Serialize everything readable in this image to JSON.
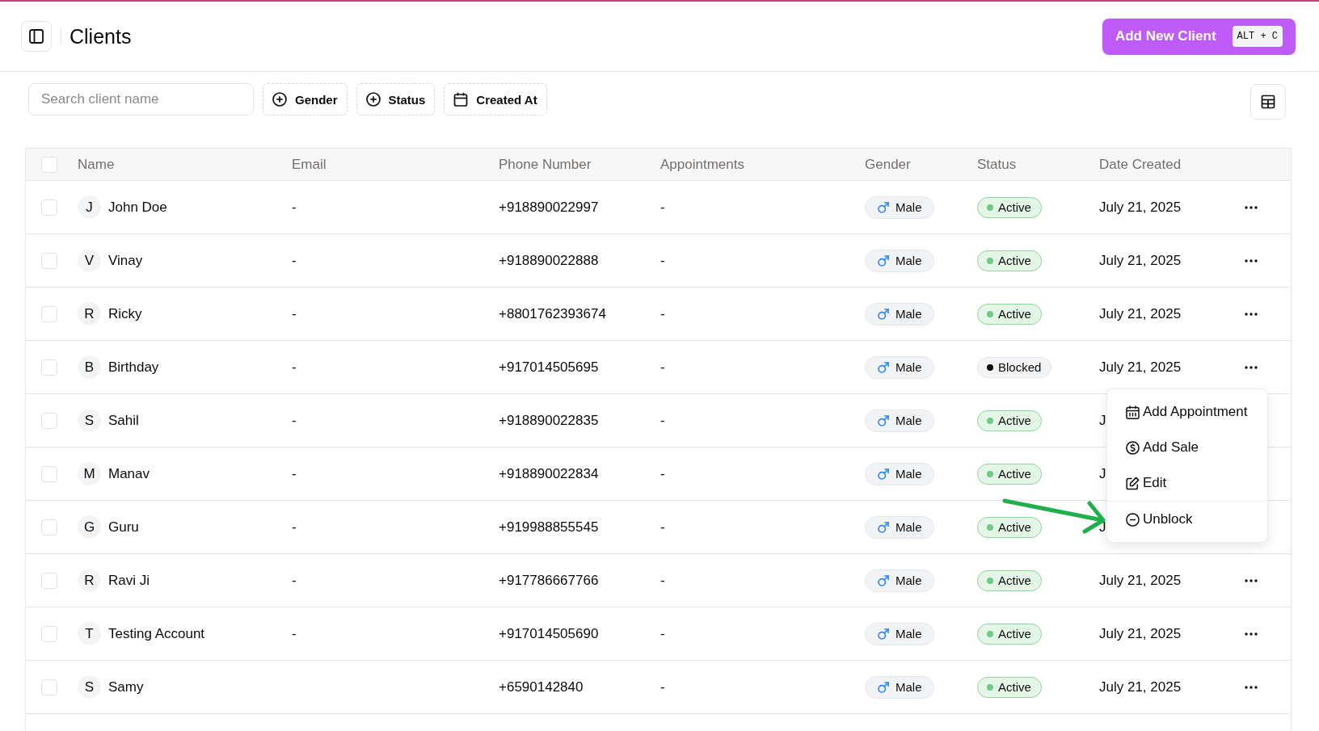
{
  "header": {
    "title": "Clients",
    "add_button": {
      "label": "Add New Client",
      "shortcut": "ALT + C"
    }
  },
  "toolbar": {
    "search": {
      "placeholder": "Search client name"
    },
    "filters": [
      {
        "label": "Gender",
        "kind": "add"
      },
      {
        "label": "Status",
        "kind": "add"
      },
      {
        "label": "Created At",
        "kind": "calendar"
      }
    ]
  },
  "table": {
    "select_all": {
      "checked": false
    },
    "columns": [
      "Name",
      "Email",
      "Phone Number",
      "Appointments",
      "Gender",
      "Status",
      "Date Created"
    ],
    "rows": [
      {
        "checked": false,
        "initial": "J",
        "name": "John Doe",
        "email": "-",
        "phone": "+918890022997",
        "appointments": "-",
        "gender": {
          "label": "Male",
          "kind": "male"
        },
        "status": {
          "label": "Active",
          "kind": "active"
        },
        "date": "July 21, 2025"
      },
      {
        "checked": false,
        "initial": "V",
        "name": "Vinay",
        "email": "-",
        "phone": "+918890022888",
        "appointments": "-",
        "gender": {
          "label": "Male",
          "kind": "male"
        },
        "status": {
          "label": "Active",
          "kind": "active"
        },
        "date": "July 21, 2025"
      },
      {
        "checked": false,
        "initial": "R",
        "name": "Ricky",
        "email": "-",
        "phone": "+8801762393674",
        "appointments": "-",
        "gender": {
          "label": "Male",
          "kind": "male"
        },
        "status": {
          "label": "Active",
          "kind": "active"
        },
        "date": "July 21, 2025"
      },
      {
        "checked": false,
        "initial": "B",
        "name": "Birthday",
        "email": "-",
        "phone": "+917014505695",
        "appointments": "-",
        "gender": {
          "label": "Male",
          "kind": "male"
        },
        "status": {
          "label": "Blocked",
          "kind": "blocked"
        },
        "date": "July 21, 2025",
        "actions_menu": {
          "groups": [
            {
              "items": [
                {
                  "label": "Add Appointment",
                  "kind": "calendar"
                },
                {
                  "label": "Add Sale",
                  "kind": "dollar"
                },
                {
                  "label": "Edit",
                  "kind": "edit"
                }
              ]
            },
            {
              "items": [
                {
                  "label": "Unblock",
                  "kind": "unblock"
                }
              ]
            }
          ]
        }
      },
      {
        "checked": false,
        "initial": "S",
        "name": "Sahil",
        "email": "-",
        "phone": "+918890022835",
        "appointments": "-",
        "gender": {
          "label": "Male",
          "kind": "male"
        },
        "status": {
          "label": "Active",
          "kind": "active"
        },
        "date": "J"
      },
      {
        "checked": false,
        "initial": "M",
        "name": "Manav",
        "email": "-",
        "phone": "+918890022834",
        "appointments": "-",
        "gender": {
          "label": "Male",
          "kind": "male"
        },
        "status": {
          "label": "Active",
          "kind": "active"
        },
        "date": "J"
      },
      {
        "checked": false,
        "initial": "G",
        "name": "Guru",
        "email": "-",
        "phone": "+919988855545",
        "appointments": "-",
        "gender": {
          "label": "Male",
          "kind": "male"
        },
        "status": {
          "label": "Active",
          "kind": "active"
        },
        "date": "J"
      },
      {
        "checked": false,
        "initial": "R",
        "name": "Ravi Ji",
        "email": "-",
        "phone": "+917786667766",
        "appointments": "-",
        "gender": {
          "label": "Male",
          "kind": "male"
        },
        "status": {
          "label": "Active",
          "kind": "active"
        },
        "date": "July 21, 2025"
      },
      {
        "checked": false,
        "initial": "T",
        "name": "Testing Account",
        "email": "-",
        "phone": "+917014505690",
        "appointments": "-",
        "gender": {
          "label": "Male",
          "kind": "male"
        },
        "status": {
          "label": "Active",
          "kind": "active"
        },
        "date": "July 21, 2025"
      },
      {
        "checked": false,
        "initial": "S",
        "name": "Samy",
        "phone": "+6590142840",
        "appointments": "-",
        "gender": {
          "label": "Male",
          "kind": "male"
        },
        "status": {
          "label": "Active",
          "kind": "active"
        },
        "date": "July 21, 2025"
      }
    ]
  }
}
